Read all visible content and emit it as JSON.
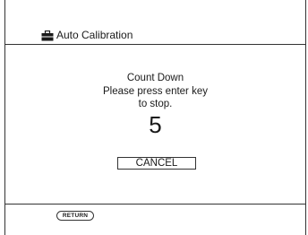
{
  "header": {
    "title": "Auto Calibration",
    "icon": "toolbox-icon"
  },
  "dialog": {
    "line1": "Count Down",
    "line2": "Please press enter key",
    "line3": "to stop.",
    "countdown": "5",
    "cancel_label": "CANCEL"
  },
  "footer": {
    "return_label": "RETURN"
  }
}
